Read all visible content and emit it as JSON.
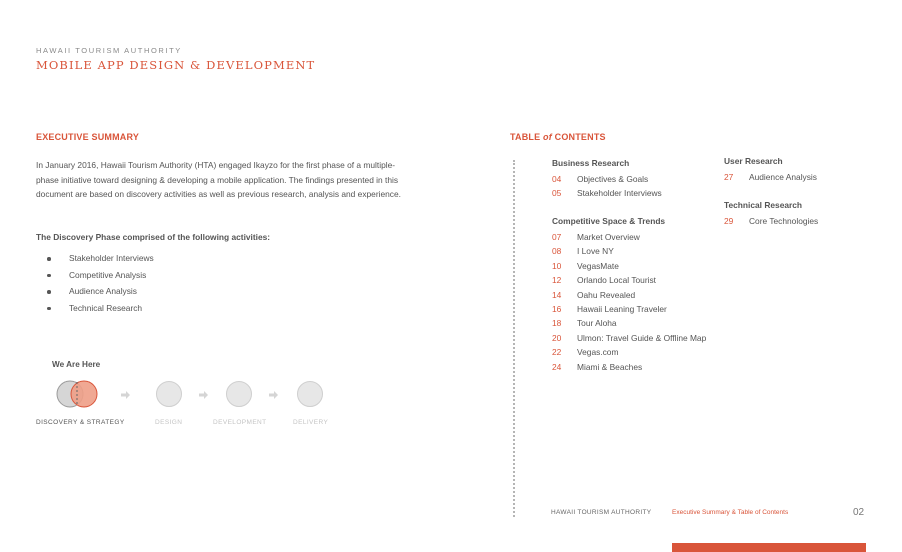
{
  "header": {
    "org": "HAWAII TOURISM AUTHORITY",
    "title": "MOBILE APP DESIGN & DEVELOPMENT"
  },
  "summary": {
    "heading": "EXECUTIVE SUMMARY",
    "lines": [
      "In January 2016, Hawaii Tourism Authority (HTA) engaged Ikayzo for the first phase of a multiple-",
      "phase initiative toward designing & developing a mobile application. The findings presented in this",
      "document are based on discovery activities as well as previous research, analysis and experience."
    ],
    "activities_heading": "The Discovery Phase comprised of the following activities:",
    "activities": [
      "Stakeholder Interviews",
      "Competitive Analysis",
      "Audience Analysis",
      "Technical Research"
    ]
  },
  "progress": {
    "here_label": "We Are Here",
    "stages": [
      {
        "label": "DISCOVERY & STRATEGY",
        "current": true
      },
      {
        "label": "DESIGN",
        "current": false
      },
      {
        "label": "DEVELOPMENT",
        "current": false
      },
      {
        "label": "DELIVERY",
        "current": false
      }
    ],
    "accent": "#d9553a",
    "inactive_color": "#c9c9c9"
  },
  "toc": {
    "heading_pre": "TABLE ",
    "heading_em": "of",
    "heading_post": " CONTENTS",
    "groups": [
      {
        "title": "Business Research",
        "items": [
          {
            "num": "04",
            "label": "Objectives & Goals"
          },
          {
            "num": "05",
            "label": "Stakeholder Interviews"
          }
        ]
      },
      {
        "title": "Competitive Space & Trends",
        "items": [
          {
            "num": "07",
            "label": "Market Overview"
          },
          {
            "num": "08",
            "label": "I Love NY"
          },
          {
            "num": "10",
            "label": "VegasMate"
          },
          {
            "num": "12",
            "label": "Orlando Local Tourist"
          },
          {
            "num": "14",
            "label": "Oahu Revealed"
          },
          {
            "num": "16",
            "label": "Hawaii Leaning Traveler"
          },
          {
            "num": "18",
            "label": "Tour Aloha"
          },
          {
            "num": "20",
            "label": "Ulmon: Travel Guide & Offline Map"
          },
          {
            "num": "22",
            "label": "Vegas.com"
          },
          {
            "num": "24",
            "label": "Miami & Beaches"
          }
        ]
      },
      {
        "title": "User Research",
        "items": [
          {
            "num": "27",
            "label": "Audience Analysis"
          }
        ]
      },
      {
        "title": "Technical Research",
        "items": [
          {
            "num": "29",
            "label": "Core Technologies"
          }
        ]
      }
    ]
  },
  "footer": {
    "org": "HAWAII TOURISM AUTHORITY",
    "section": "Executive Summary & Table of Contents",
    "page": "02"
  }
}
